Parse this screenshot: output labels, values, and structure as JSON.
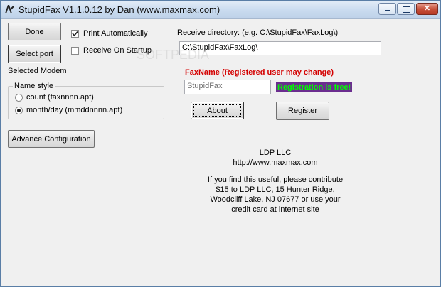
{
  "window": {
    "title": "StupidFax V1.1.0.12 by Dan (www.maxmax.com)",
    "minimize_glyph": "—",
    "maximize_glyph": "▭",
    "close_glyph": "✕"
  },
  "buttons": {
    "done": "Done",
    "select_port": "Select port",
    "advance_config": "Advance Configuration",
    "about": "About",
    "register": "Register"
  },
  "options": {
    "print_automatically": {
      "label": "Print Automatically",
      "checked": true
    },
    "receive_on_startup": {
      "label": "Receive On Startup",
      "checked": false
    }
  },
  "selected_modem_label": "Selected Modem",
  "name_style": {
    "title": "Name style",
    "options": [
      {
        "label": "count (faxnnnn.apf)",
        "selected": false
      },
      {
        "label": "month/day (mmddnnnn.apf)",
        "selected": true
      }
    ]
  },
  "receive_directory": {
    "label": "Receive directory:  (e.g.  C:\\StupidFax\\FaxLog\\)",
    "value": "C:\\StupidFax\\FaxLog\\"
  },
  "fax_name": {
    "label": "FaxName (Registered  user may change)",
    "value": "StupidFax",
    "registration_note": "Registration is free!"
  },
  "info": {
    "company": "LDP LLC",
    "url": "http://www.maxmax.com",
    "contribute_lines": [
      "If you find this useful, please contribute",
      "$15 to LDP LLC, 15 Hunter Ridge,",
      "Woodcliff Lake, NJ 07677 or use your",
      "credit card at internet site"
    ]
  },
  "icons": [
    "app-fax-icon",
    "check-mark-icon",
    "minimize-icon",
    "maximize-icon",
    "close-icon"
  ],
  "colors": {
    "red_label": "#d40000",
    "reg_bg": "#6b2d8f",
    "reg_text": "#00ff00"
  }
}
